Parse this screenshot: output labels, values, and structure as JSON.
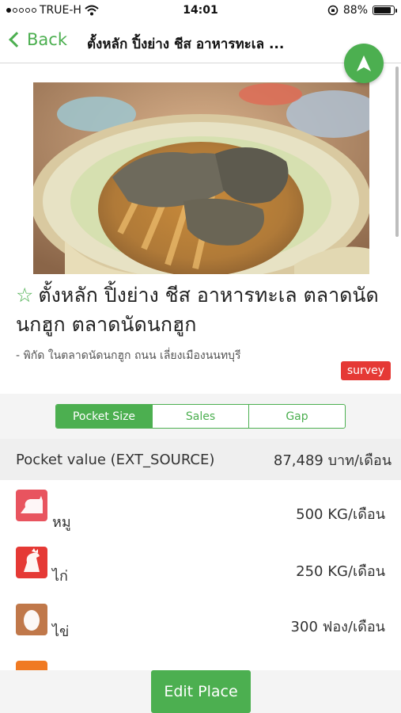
{
  "status_bar": {
    "carrier": "TRUE-H",
    "time": "14:01",
    "battery_text": "88%",
    "battery_level": 0.88,
    "icons": [
      "signal-dots",
      "wifi-icon",
      "rotation-lock-icon",
      "battery-icon"
    ]
  },
  "nav": {
    "back_label": "Back",
    "title": "ตั้งหลัก ปิ้งย่าง ชีส อาหารทะเล ...",
    "fab_icon": "navigation-arrow-icon"
  },
  "place": {
    "star": "☆",
    "title": "ตั้งหลัก ปิ้งย่าง ชีส อาหารทะเล ตลาดนัดนกฮูก ตลาดนัดนกฮูก",
    "address": "- พิกัด ในตลาดนัดนกฮูก ถนน เลี่ยงเมืองนนทบุรี",
    "badge": "survey"
  },
  "tabs": [
    {
      "label": "Pocket Size",
      "active": true
    },
    {
      "label": "Sales",
      "active": false
    },
    {
      "label": "Gap",
      "active": false
    }
  ],
  "pocket": {
    "label": "Pocket value (EXT_SOURCE)",
    "value": "87,489 บาท/เดือน"
  },
  "items": [
    {
      "label": "หมู",
      "value": "500 KG/เดือน",
      "icon": "pig-icon",
      "color": "#e8545f"
    },
    {
      "label": "ไก่",
      "value": "250 KG/เดือน",
      "icon": "chicken-icon",
      "color": "#e53935"
    },
    {
      "label": "ไข่",
      "value": "300 ฟอง/เดือน",
      "icon": "egg-icon",
      "color": "#c0784a"
    }
  ],
  "partial_item_color": "#f07a23",
  "actions": {
    "edit_label": "Edit Place"
  },
  "colors": {
    "accent": "#4caf50",
    "badge": "#e53935"
  }
}
